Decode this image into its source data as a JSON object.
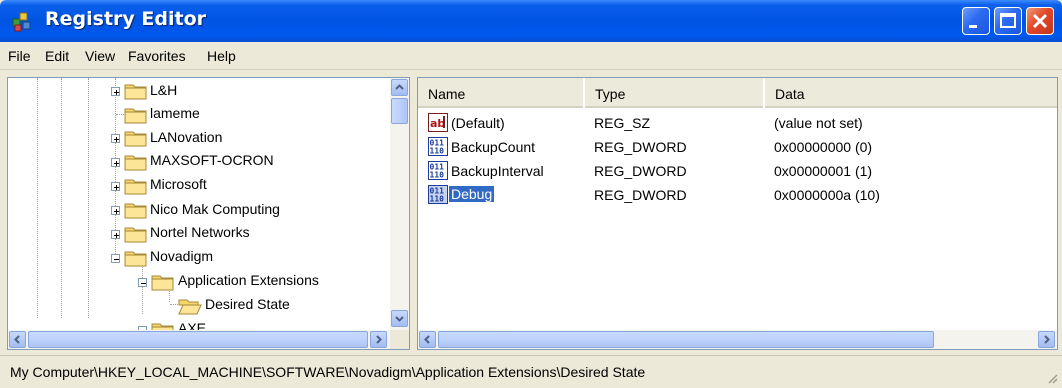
{
  "window": {
    "title": "Registry Editor"
  },
  "menu": [
    "File",
    "Edit",
    "View",
    "Favorites",
    "Help"
  ],
  "tree": {
    "items": [
      {
        "label": "L&H",
        "expander": "+"
      },
      {
        "label": "lameme",
        "expander": ""
      },
      {
        "label": "LANovation",
        "expander": "+"
      },
      {
        "label": "MAXSOFT-OCRON",
        "expander": "+"
      },
      {
        "label": "Microsoft",
        "expander": "+"
      },
      {
        "label": "Nico Mak Computing",
        "expander": "+"
      },
      {
        "label": "Nortel Networks",
        "expander": "+"
      },
      {
        "label": "Novadigm",
        "expander": "-"
      },
      {
        "label": "Application Extensions",
        "expander": "-"
      },
      {
        "label": "Desired State",
        "expander": ""
      },
      {
        "label": "AXE",
        "expander": "-"
      }
    ]
  },
  "list": {
    "columns": [
      "Name",
      "Type",
      "Data"
    ],
    "rows": [
      {
        "icon": "string-value-icon",
        "name": "(Default)",
        "type": "REG_SZ",
        "data": "(value not set)"
      },
      {
        "icon": "dword-value-icon",
        "name": "BackupCount",
        "type": "REG_DWORD",
        "data": "0x00000000 (0)"
      },
      {
        "icon": "dword-value-icon",
        "name": "BackupInterval",
        "type": "REG_DWORD",
        "data": "0x00000001 (1)"
      },
      {
        "icon": "dword-value-icon",
        "name": "Debug",
        "type": "REG_DWORD",
        "data": "0x0000000a (10)"
      }
    ]
  },
  "status": {
    "path": "My Computer\\HKEY_LOCAL_MACHINE\\SOFTWARE\\Novadigm\\Application Extensions\\Desired State"
  },
  "colors": {
    "title_bar": "#0054e3",
    "selection": "#316ac5",
    "pane_border": "#7f9db9"
  }
}
